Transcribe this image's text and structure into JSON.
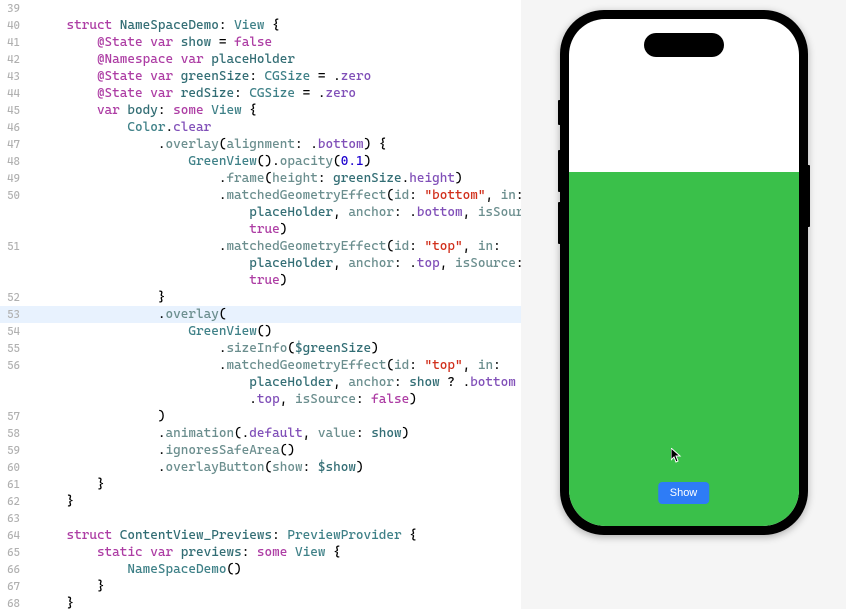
{
  "code": {
    "lines": [
      {
        "num": 39,
        "indent": 0,
        "tokens": []
      },
      {
        "num": 40,
        "indent": 1,
        "tokens": [
          {
            "cls": "kw-pink",
            "t": "struct"
          },
          {
            "cls": "punct",
            "t": " "
          },
          {
            "cls": "prop-blue",
            "t": "NameSpaceDemo"
          },
          {
            "cls": "punct",
            "t": ": "
          },
          {
            "cls": "type-teal",
            "t": "View"
          },
          {
            "cls": "punct",
            "t": " {"
          }
        ]
      },
      {
        "num": 41,
        "indent": 2,
        "tokens": [
          {
            "cls": "kw-pink",
            "t": "@State"
          },
          {
            "cls": "punct",
            "t": " "
          },
          {
            "cls": "kw-pink",
            "t": "var"
          },
          {
            "cls": "punct",
            "t": " "
          },
          {
            "cls": "prop-blue",
            "t": "show"
          },
          {
            "cls": "punct",
            "t": " = "
          },
          {
            "cls": "kw-pink",
            "t": "false"
          }
        ]
      },
      {
        "num": 42,
        "indent": 2,
        "tokens": [
          {
            "cls": "kw-pink",
            "t": "@Namespace"
          },
          {
            "cls": "punct",
            "t": " "
          },
          {
            "cls": "kw-pink",
            "t": "var"
          },
          {
            "cls": "punct",
            "t": " "
          },
          {
            "cls": "prop-blue",
            "t": "placeHolder"
          }
        ]
      },
      {
        "num": 43,
        "indent": 2,
        "tokens": [
          {
            "cls": "kw-pink",
            "t": "@State"
          },
          {
            "cls": "punct",
            "t": " "
          },
          {
            "cls": "kw-pink",
            "t": "var"
          },
          {
            "cls": "punct",
            "t": " "
          },
          {
            "cls": "prop-blue",
            "t": "greenSize"
          },
          {
            "cls": "punct",
            "t": ": "
          },
          {
            "cls": "type-teal",
            "t": "CGSize"
          },
          {
            "cls": "punct",
            "t": " = ."
          },
          {
            "cls": "enum-purple",
            "t": "zero"
          }
        ]
      },
      {
        "num": 44,
        "indent": 2,
        "tokens": [
          {
            "cls": "kw-pink",
            "t": "@State"
          },
          {
            "cls": "punct",
            "t": " "
          },
          {
            "cls": "kw-pink",
            "t": "var"
          },
          {
            "cls": "punct",
            "t": " "
          },
          {
            "cls": "prop-blue",
            "t": "redSize"
          },
          {
            "cls": "punct",
            "t": ": "
          },
          {
            "cls": "type-teal",
            "t": "CGSize"
          },
          {
            "cls": "punct",
            "t": " = ."
          },
          {
            "cls": "enum-purple",
            "t": "zero"
          }
        ]
      },
      {
        "num": 45,
        "indent": 2,
        "tokens": [
          {
            "cls": "kw-pink",
            "t": "var"
          },
          {
            "cls": "punct",
            "t": " "
          },
          {
            "cls": "prop-blue",
            "t": "body"
          },
          {
            "cls": "punct",
            "t": ": "
          },
          {
            "cls": "kw-pink",
            "t": "some"
          },
          {
            "cls": "punct",
            "t": " "
          },
          {
            "cls": "type-teal",
            "t": "View"
          },
          {
            "cls": "punct",
            "t": " {"
          }
        ]
      },
      {
        "num": 46,
        "indent": 3,
        "tokens": [
          {
            "cls": "type-teal",
            "t": "Color"
          },
          {
            "cls": "punct",
            "t": "."
          },
          {
            "cls": "enum-purple",
            "t": "clear"
          }
        ]
      },
      {
        "num": 47,
        "indent": 4,
        "tokens": [
          {
            "cls": "punct",
            "t": "."
          },
          {
            "cls": "func-teal",
            "t": "overlay"
          },
          {
            "cls": "punct",
            "t": "("
          },
          {
            "cls": "func-teal",
            "t": "alignment"
          },
          {
            "cls": "punct",
            "t": ": ."
          },
          {
            "cls": "enum-purple",
            "t": "bottom"
          },
          {
            "cls": "punct",
            "t": ") {"
          }
        ]
      },
      {
        "num": 48,
        "indent": 5,
        "tokens": [
          {
            "cls": "type-teal",
            "t": "GreenView"
          },
          {
            "cls": "punct",
            "t": "()."
          },
          {
            "cls": "func-teal",
            "t": "opacity"
          },
          {
            "cls": "punct",
            "t": "("
          },
          {
            "cls": "num-blue",
            "t": "0.1"
          },
          {
            "cls": "punct",
            "t": ")"
          }
        ]
      },
      {
        "num": 49,
        "indent": 6,
        "tokens": [
          {
            "cls": "punct",
            "t": "."
          },
          {
            "cls": "func-teal",
            "t": "frame"
          },
          {
            "cls": "punct",
            "t": "("
          },
          {
            "cls": "func-teal",
            "t": "height"
          },
          {
            "cls": "punct",
            "t": ": "
          },
          {
            "cls": "prop-blue",
            "t": "greenSize"
          },
          {
            "cls": "punct",
            "t": "."
          },
          {
            "cls": "enum-purple",
            "t": "height"
          },
          {
            "cls": "punct",
            "t": ")"
          }
        ]
      },
      {
        "num": 50,
        "indent": 6,
        "tokens": [
          {
            "cls": "punct",
            "t": "."
          },
          {
            "cls": "func-teal",
            "t": "matchedGeometryEffect"
          },
          {
            "cls": "punct",
            "t": "("
          },
          {
            "cls": "func-teal",
            "t": "id"
          },
          {
            "cls": "punct",
            "t": ": "
          },
          {
            "cls": "str-red",
            "t": "\"bottom\""
          },
          {
            "cls": "punct",
            "t": ", "
          },
          {
            "cls": "func-teal",
            "t": "in"
          },
          {
            "cls": "punct",
            "t": ": "
          }
        ]
      },
      {
        "num": "",
        "indent": 7,
        "tokens": [
          {
            "cls": "prop-blue",
            "t": "placeHolder"
          },
          {
            "cls": "punct",
            "t": ", "
          },
          {
            "cls": "func-teal",
            "t": "anchor"
          },
          {
            "cls": "punct",
            "t": ": ."
          },
          {
            "cls": "enum-purple",
            "t": "bottom"
          },
          {
            "cls": "punct",
            "t": ", "
          },
          {
            "cls": "func-teal",
            "t": "isSource"
          },
          {
            "cls": "punct",
            "t": ": "
          }
        ]
      },
      {
        "num": "",
        "indent": 7,
        "tokens": [
          {
            "cls": "kw-pink",
            "t": "true"
          },
          {
            "cls": "punct",
            "t": ")"
          }
        ]
      },
      {
        "num": 51,
        "indent": 6,
        "tokens": [
          {
            "cls": "punct",
            "t": "."
          },
          {
            "cls": "func-teal",
            "t": "matchedGeometryEffect"
          },
          {
            "cls": "punct",
            "t": "("
          },
          {
            "cls": "func-teal",
            "t": "id"
          },
          {
            "cls": "punct",
            "t": ": "
          },
          {
            "cls": "str-red",
            "t": "\"top\""
          },
          {
            "cls": "punct",
            "t": ", "
          },
          {
            "cls": "func-teal",
            "t": "in"
          },
          {
            "cls": "punct",
            "t": ": "
          }
        ]
      },
      {
        "num": "",
        "indent": 7,
        "tokens": [
          {
            "cls": "prop-blue",
            "t": "placeHolder"
          },
          {
            "cls": "punct",
            "t": ", "
          },
          {
            "cls": "func-teal",
            "t": "anchor"
          },
          {
            "cls": "punct",
            "t": ": ."
          },
          {
            "cls": "enum-purple",
            "t": "top"
          },
          {
            "cls": "punct",
            "t": ", "
          },
          {
            "cls": "func-teal",
            "t": "isSource"
          },
          {
            "cls": "punct",
            "t": ": "
          }
        ]
      },
      {
        "num": "",
        "indent": 7,
        "tokens": [
          {
            "cls": "kw-pink",
            "t": "true"
          },
          {
            "cls": "punct",
            "t": ")"
          }
        ]
      },
      {
        "num": 52,
        "indent": 4,
        "tokens": [
          {
            "cls": "punct",
            "t": "}"
          }
        ]
      },
      {
        "num": 53,
        "indent": 4,
        "highlighted": true,
        "tokens": [
          {
            "cls": "punct",
            "t": "."
          },
          {
            "cls": "func-teal",
            "t": "overlay"
          },
          {
            "cls": "punct",
            "t": "("
          }
        ]
      },
      {
        "num": 54,
        "indent": 5,
        "tokens": [
          {
            "cls": "type-teal",
            "t": "GreenView"
          },
          {
            "cls": "punct",
            "t": "()"
          }
        ]
      },
      {
        "num": 55,
        "indent": 6,
        "tokens": [
          {
            "cls": "punct",
            "t": "."
          },
          {
            "cls": "func-teal",
            "t": "sizeInfo"
          },
          {
            "cls": "punct",
            "t": "("
          },
          {
            "cls": "prop-blue",
            "t": "$greenSize"
          },
          {
            "cls": "punct",
            "t": ")"
          }
        ]
      },
      {
        "num": 56,
        "indent": 6,
        "tokens": [
          {
            "cls": "punct",
            "t": "."
          },
          {
            "cls": "func-teal",
            "t": "matchedGeometryEffect"
          },
          {
            "cls": "punct",
            "t": "("
          },
          {
            "cls": "func-teal",
            "t": "id"
          },
          {
            "cls": "punct",
            "t": ": "
          },
          {
            "cls": "str-red",
            "t": "\"top\""
          },
          {
            "cls": "punct",
            "t": ", "
          },
          {
            "cls": "func-teal",
            "t": "in"
          },
          {
            "cls": "punct",
            "t": ": "
          }
        ]
      },
      {
        "num": "",
        "indent": 7,
        "tokens": [
          {
            "cls": "prop-blue",
            "t": "placeHolder"
          },
          {
            "cls": "punct",
            "t": ", "
          },
          {
            "cls": "func-teal",
            "t": "anchor"
          },
          {
            "cls": "punct",
            "t": ": "
          },
          {
            "cls": "prop-blue",
            "t": "show"
          },
          {
            "cls": "punct",
            "t": " ? ."
          },
          {
            "cls": "enum-purple",
            "t": "bottom"
          },
          {
            "cls": "punct",
            "t": " : "
          }
        ]
      },
      {
        "num": "",
        "indent": 7,
        "tokens": [
          {
            "cls": "punct",
            "t": "."
          },
          {
            "cls": "enum-purple",
            "t": "top"
          },
          {
            "cls": "punct",
            "t": ", "
          },
          {
            "cls": "func-teal",
            "t": "isSource"
          },
          {
            "cls": "punct",
            "t": ": "
          },
          {
            "cls": "kw-pink",
            "t": "false"
          },
          {
            "cls": "punct",
            "t": ")"
          }
        ]
      },
      {
        "num": 57,
        "indent": 4,
        "tokens": [
          {
            "cls": "punct",
            "t": ")"
          }
        ]
      },
      {
        "num": 58,
        "indent": 4,
        "tokens": [
          {
            "cls": "punct",
            "t": "."
          },
          {
            "cls": "func-teal",
            "t": "animation"
          },
          {
            "cls": "punct",
            "t": "(."
          },
          {
            "cls": "enum-purple",
            "t": "default"
          },
          {
            "cls": "punct",
            "t": ", "
          },
          {
            "cls": "func-teal",
            "t": "value"
          },
          {
            "cls": "punct",
            "t": ": "
          },
          {
            "cls": "prop-blue",
            "t": "show"
          },
          {
            "cls": "punct",
            "t": ")"
          }
        ]
      },
      {
        "num": 59,
        "indent": 4,
        "tokens": [
          {
            "cls": "punct",
            "t": "."
          },
          {
            "cls": "func-teal",
            "t": "ignoresSafeArea"
          },
          {
            "cls": "punct",
            "t": "()"
          }
        ]
      },
      {
        "num": 60,
        "indent": 4,
        "tokens": [
          {
            "cls": "punct",
            "t": "."
          },
          {
            "cls": "func-teal",
            "t": "overlayButton"
          },
          {
            "cls": "punct",
            "t": "("
          },
          {
            "cls": "func-teal",
            "t": "show"
          },
          {
            "cls": "punct",
            "t": ": "
          },
          {
            "cls": "prop-blue",
            "t": "$show"
          },
          {
            "cls": "punct",
            "t": ")"
          }
        ]
      },
      {
        "num": 61,
        "indent": 2,
        "tokens": [
          {
            "cls": "punct",
            "t": "}"
          }
        ]
      },
      {
        "num": 62,
        "indent": 1,
        "tokens": [
          {
            "cls": "punct",
            "t": "}"
          }
        ]
      },
      {
        "num": 63,
        "indent": 0,
        "tokens": []
      },
      {
        "num": 64,
        "indent": 1,
        "tokens": [
          {
            "cls": "kw-pink",
            "t": "struct"
          },
          {
            "cls": "punct",
            "t": " "
          },
          {
            "cls": "prop-blue",
            "t": "ContentView_Previews"
          },
          {
            "cls": "punct",
            "t": ": "
          },
          {
            "cls": "type-teal",
            "t": "PreviewProvider"
          },
          {
            "cls": "punct",
            "t": " {"
          }
        ]
      },
      {
        "num": 65,
        "indent": 2,
        "tokens": [
          {
            "cls": "kw-pink",
            "t": "static"
          },
          {
            "cls": "punct",
            "t": " "
          },
          {
            "cls": "kw-pink",
            "t": "var"
          },
          {
            "cls": "punct",
            "t": " "
          },
          {
            "cls": "prop-blue",
            "t": "previews"
          },
          {
            "cls": "punct",
            "t": ": "
          },
          {
            "cls": "kw-pink",
            "t": "some"
          },
          {
            "cls": "punct",
            "t": " "
          },
          {
            "cls": "type-teal",
            "t": "View"
          },
          {
            "cls": "punct",
            "t": " {"
          }
        ]
      },
      {
        "num": 66,
        "indent": 3,
        "tokens": [
          {
            "cls": "type-teal",
            "t": "NameSpaceDemo"
          },
          {
            "cls": "punct",
            "t": "()"
          }
        ]
      },
      {
        "num": 67,
        "indent": 2,
        "tokens": [
          {
            "cls": "punct",
            "t": "}"
          }
        ]
      },
      {
        "num": 68,
        "indent": 1,
        "tokens": [
          {
            "cls": "punct",
            "t": "}"
          }
        ]
      }
    ]
  },
  "preview": {
    "button_label": "Show",
    "green_color": "#3ac04a",
    "button_color": "#2e7cf6"
  }
}
